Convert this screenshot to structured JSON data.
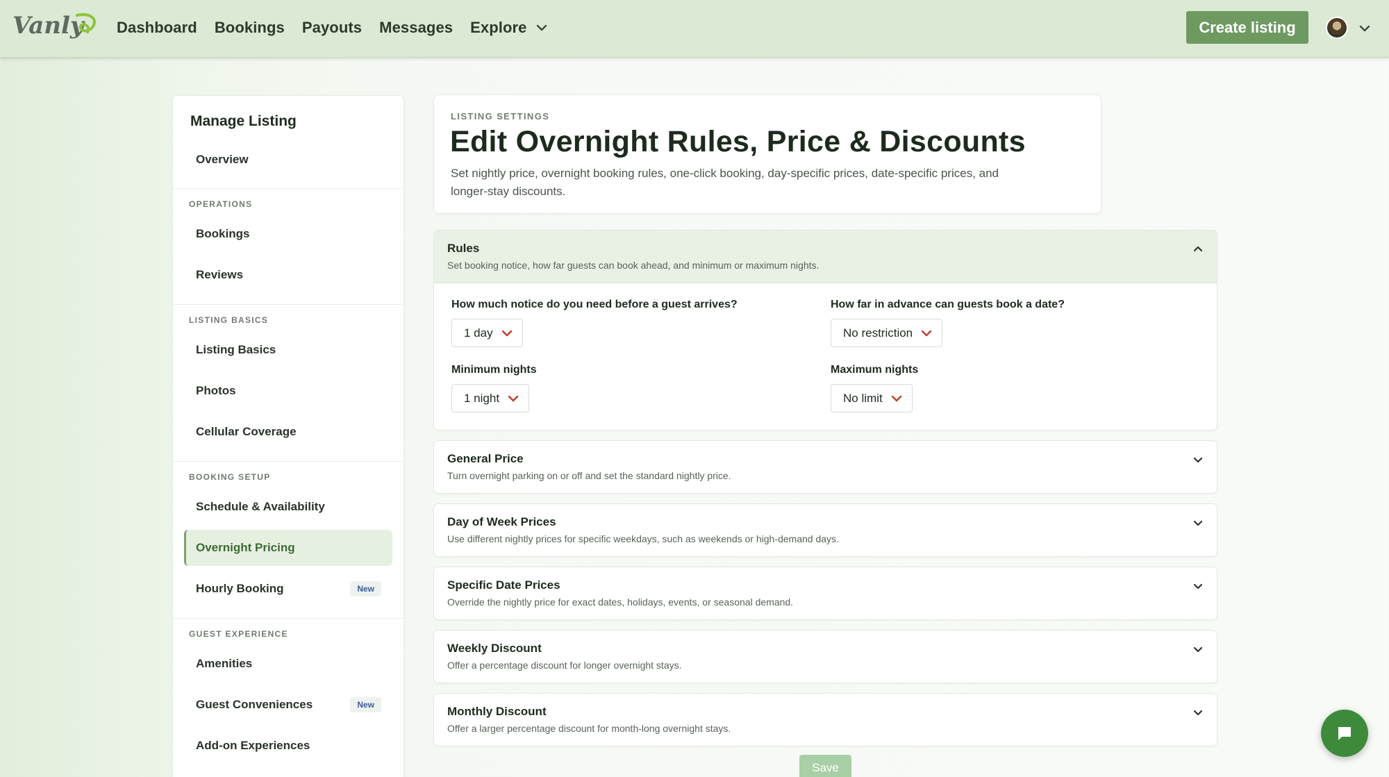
{
  "nav": {
    "logo_text": "Vanly",
    "items": [
      "Dashboard",
      "Bookings",
      "Payouts",
      "Messages",
      "Explore"
    ],
    "create_label": "Create listing"
  },
  "sidebar": {
    "title": "Manage Listing",
    "overview": "Overview",
    "sections": {
      "operations": "OPERATIONS",
      "listing_basics": "LISTING BASICS",
      "booking_setup": "BOOKING SETUP",
      "guest_experience": "GUEST EXPERIENCE"
    },
    "items": {
      "bookings": "Bookings",
      "reviews": "Reviews",
      "listing_basics": "Listing Basics",
      "photos": "Photos",
      "cellular": "Cellular Coverage",
      "schedule": "Schedule & Availability",
      "overnight": "Overnight Pricing",
      "hourly": "Hourly Booking",
      "amenities": "Amenities",
      "conveniences": "Guest Conveniences",
      "addons": "Add-on Experiences"
    },
    "badge_new": "New"
  },
  "header": {
    "eyebrow": "LISTING SETTINGS",
    "title": "Edit Overnight Rules, Price & Discounts",
    "subtitle": "Set nightly price, overnight booking rules, one-click booking, day-specific prices, date-specific prices, and longer-stay discounts."
  },
  "rules": {
    "title": "Rules",
    "subtitle": "Set booking notice, how far guests can book ahead, and minimum or maximum nights.",
    "notice_label": "How much notice do you need before a guest arrives?",
    "notice_value": "1 day",
    "advance_label": "How far in advance can guests book a date?",
    "advance_value": "No restriction",
    "min_label": "Minimum nights",
    "min_value": "1 night",
    "max_label": "Maximum nights",
    "max_value": "No limit"
  },
  "panels": {
    "general": {
      "title": "General Price",
      "subtitle": "Turn overnight parking on or off and set the standard nightly price."
    },
    "dow": {
      "title": "Day of Week Prices",
      "subtitle": "Use different nightly prices for specific weekdays, such as weekends or high-demand days."
    },
    "specific": {
      "title": "Specific Date Prices",
      "subtitle": "Override the nightly price for exact dates, holidays, events, or seasonal demand."
    },
    "weekly": {
      "title": "Weekly Discount",
      "subtitle": "Offer a percentage discount for longer overnight stays."
    },
    "monthly": {
      "title": "Monthly Discount",
      "subtitle": "Offer a larger percentage discount for month-long overnight stays."
    }
  },
  "save_label": "Save",
  "icons": {
    "chevron": "chevron-down-icon",
    "chevron_up": "chevron-up-icon",
    "chat": "chat-icon"
  },
  "colors": {
    "brand_green": "#6e9a62",
    "select_chevron": "#c0392b",
    "chat_green": "#3d8a3b"
  }
}
